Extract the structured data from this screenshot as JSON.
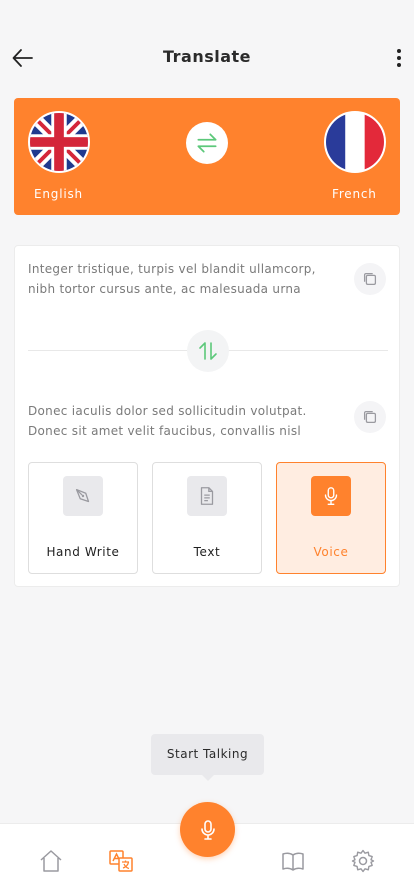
{
  "header": {
    "title": "Translate",
    "back_icon": "arrow-left-icon",
    "more_icon": "more-vertical-icon"
  },
  "languages": {
    "source": {
      "label": "English",
      "flag": "uk-flag"
    },
    "target": {
      "label": "French",
      "flag": "france-flag"
    },
    "swap_icon": "swap-horizontal-icon"
  },
  "translation": {
    "source_text": "Integer tristique, turpis vel blandit ullamcorp, nibh tortor cursus ante, ac malesuada urna",
    "target_text": "Donec iaculis dolor sed sollicitudin volutpat. Donec sit amet velit faucibus, convallis nisl",
    "copy_icon": "copy-icon",
    "swap_icon": "swap-vertical-icon"
  },
  "modes": {
    "hand_write": "Hand Write",
    "text": "Text",
    "voice": "Voice",
    "selected": "Voice"
  },
  "tooltip": {
    "text": "Start Talking"
  },
  "bottom_nav": {
    "items": [
      "home-icon",
      "translate-icon",
      "book-icon",
      "settings-icon"
    ],
    "active": "translate-icon",
    "fab_icon": "microphone-icon"
  },
  "colors": {
    "accent": "#ff822d",
    "accent_light": "#ffede1",
    "swap_green": "#5cc87a",
    "icon_gray": "#9a9aa0"
  }
}
